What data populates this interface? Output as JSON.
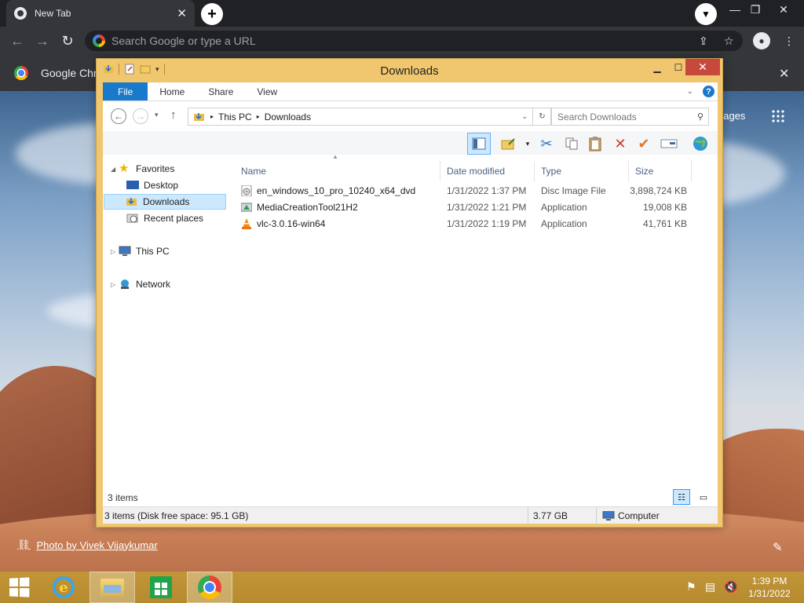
{
  "chrome": {
    "tab_title": "New Tab",
    "tab_close": "✕",
    "new_tab": "+",
    "omnibox_placeholder": "Search Google or type a URL",
    "infobar_text": "Google Chro",
    "images_link": "nages",
    "photo_credit": "Photo by Vivek Vijaykumar"
  },
  "explorer": {
    "title": "Downloads",
    "ribbon_tabs": [
      "File",
      "Home",
      "Share",
      "View"
    ],
    "breadcrumb": [
      "This PC",
      "Downloads"
    ],
    "search_placeholder": "Search Downloads",
    "nav": {
      "favorites": "Favorites",
      "desktop": "Desktop",
      "downloads": "Downloads",
      "recent": "Recent places",
      "this_pc": "This PC",
      "network": "Network"
    },
    "columns": [
      "Name",
      "Date modified",
      "Type",
      "Size"
    ],
    "files": [
      {
        "name": "en_windows_10_pro_10240_x64_dvd",
        "date": "1/31/2022 1:37 PM",
        "type": "Disc Image File",
        "size": "3,898,724 KB"
      },
      {
        "name": "MediaCreationTool21H2",
        "date": "1/31/2022 1:21 PM",
        "type": "Application",
        "size": "19,008 KB"
      },
      {
        "name": "vlc-3.0.16-win64",
        "date": "1/31/2022 1:19 PM",
        "type": "Application",
        "size": "41,761 KB"
      }
    ],
    "item_count": "3 items",
    "status": {
      "left": "3 items (Disk free space: 95.1 GB)",
      "size": "3.77 GB",
      "location": "Computer"
    }
  },
  "taskbar": {
    "time": "1:39 PM",
    "date": "1/31/2022"
  }
}
